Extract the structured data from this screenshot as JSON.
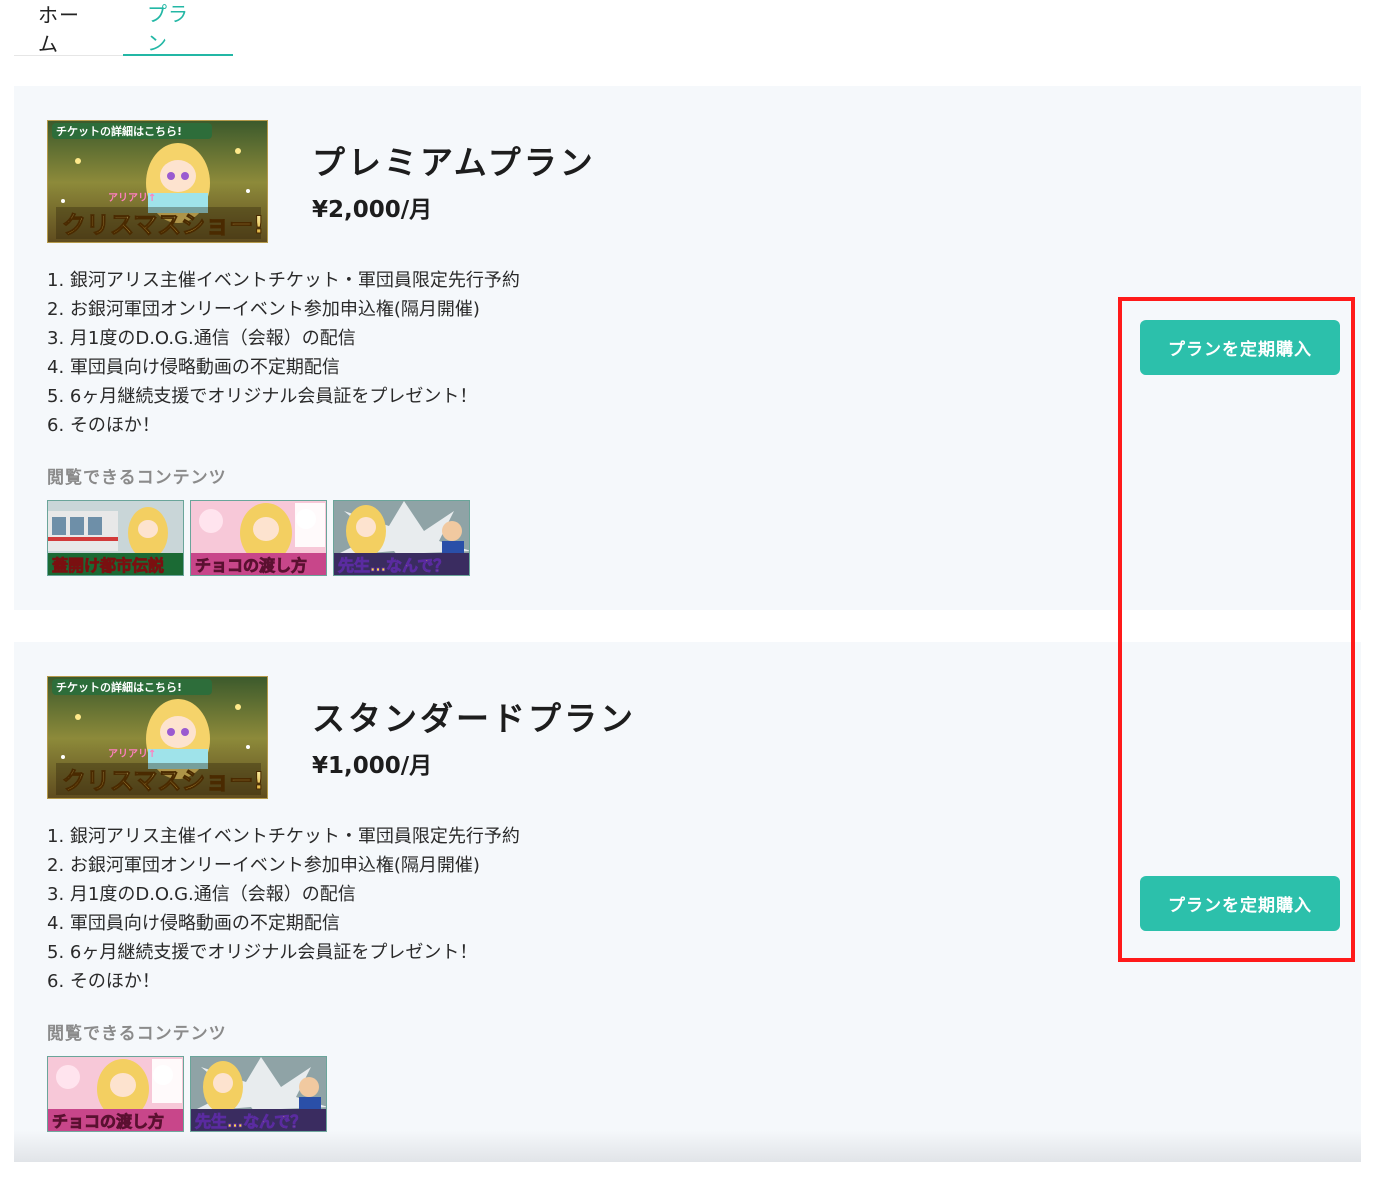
{
  "tabs": [
    {
      "label": "ホーム",
      "active": false
    },
    {
      "label": "プラン",
      "active": true
    }
  ],
  "plans": [
    {
      "title": "プレミアムプラン",
      "price": "¥2,000/月",
      "benefits": [
        "1. 銀河アリス主催イベントチケット・軍団員限定先行予約",
        "2. お銀河軍団オンリーイベント参加申込権(隔月開催)",
        "3. 月1度のD.O.G.通信（会報）の配信",
        "4. 軍団員向け侵略動画の不定期配信",
        "5. 6ヶ月継続支援でオリジナル会員証をプレゼント！",
        "6. そのほか！"
      ],
      "contents_label": "閲覧できるコンテンツ",
      "contents": [
        "蓋開け都市伝説",
        "チョコの渡し方",
        "先生…なんで？"
      ],
      "button_label": "プランを定期購入"
    },
    {
      "title": "スタンダードプラン",
      "price": "¥1,000/月",
      "benefits": [
        "1. 銀河アリス主催イベントチケット・軍団員限定先行予約",
        "2. お銀河軍団オンリーイベント参加申込権(隔月開催)",
        "3. 月1度のD.O.G.通信（会報）の配信",
        "4. 軍団員向け侵略動画の不定期配信",
        "5. 6ヶ月継続支援でオリジナル会員証をプレゼント！",
        "6. そのほか！"
      ],
      "contents_label": "閲覧できるコンテンツ",
      "contents": [
        "チョコの渡し方",
        "先生…なんで？"
      ],
      "button_label": "プランを定期購入"
    }
  ],
  "thumbnail_main_text": {
    "top": "チケットの詳細はこちら!",
    "mid": "アリアリ↑",
    "main": "クリスマスショー!"
  },
  "colors": {
    "accent": "#2cc0ab",
    "tab_active": "#23b7a5",
    "highlight": "#ff1a1a",
    "card_bg": "#f5f8fb"
  }
}
